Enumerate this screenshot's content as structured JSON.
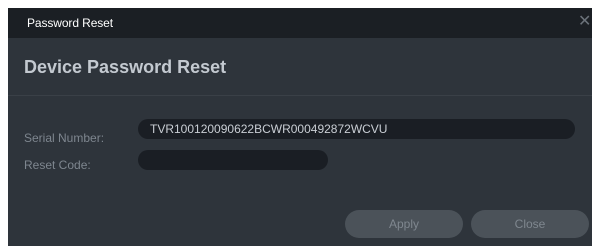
{
  "window": {
    "title": "Password Reset",
    "close_icon": "close-icon"
  },
  "dialog": {
    "heading": "Device Password Reset"
  },
  "form": {
    "serial_label": "Serial Number:",
    "serial_value": "TVR100120090622BCWR000492872WCVU",
    "reset_label": "Reset Code:",
    "reset_value": ""
  },
  "buttons": {
    "apply_label": "Apply",
    "close_label": "Close"
  },
  "colors": {
    "dialog_bg": "#2e343b",
    "titlebar_bg": "#1b1f24",
    "input_bg": "#1a1e24",
    "button_bg": "#4b5259"
  }
}
